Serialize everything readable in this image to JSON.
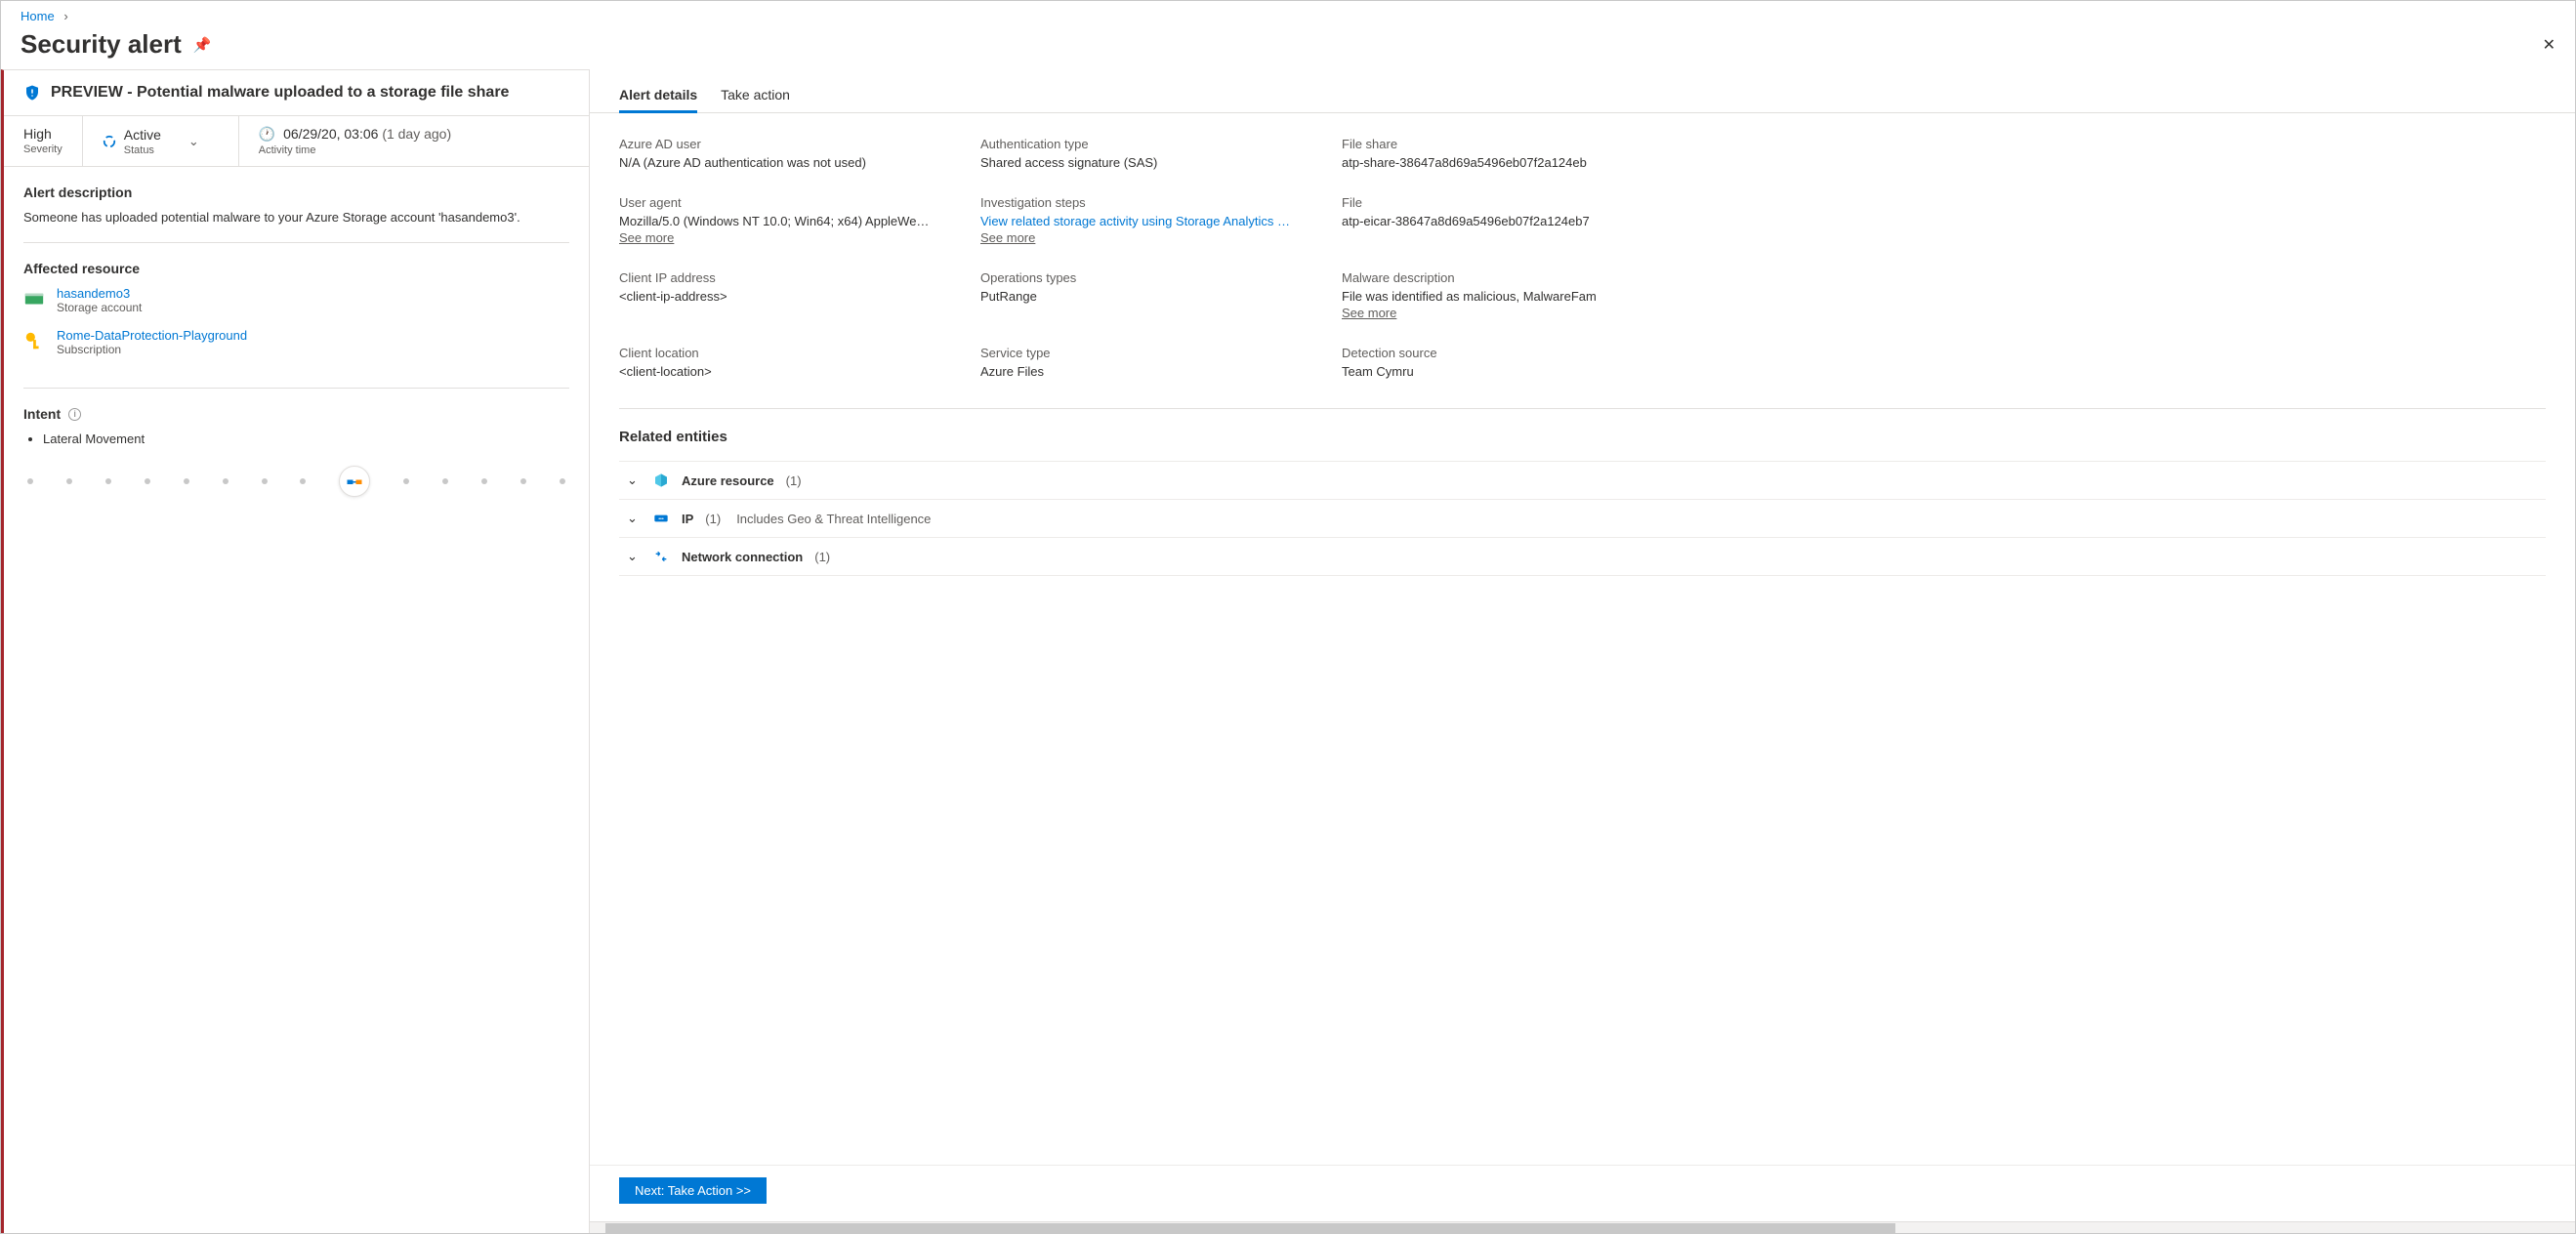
{
  "breadcrumb": {
    "home": "Home"
  },
  "pageTitle": "Security alert",
  "alertTitle": "PREVIEW - Potential malware uploaded to a storage file share",
  "metrics": {
    "severityValue": "High",
    "severityLabel": "Severity",
    "statusValue": "Active",
    "statusLabel": "Status",
    "timeValue": "06/29/20, 03:06",
    "timeAgo": "(1 day ago)",
    "timeLabel": "Activity time"
  },
  "alertDescription": {
    "title": "Alert description",
    "text": "Someone has uploaded potential malware to your Azure Storage account 'hasandemo3'."
  },
  "affectedResource": {
    "title": "Affected resource",
    "storage": {
      "name": "hasandemo3",
      "type": "Storage account"
    },
    "subscription": {
      "name": "Rome-DataProtection-Playground",
      "type": "Subscription"
    }
  },
  "intent": {
    "title": "Intent",
    "items": [
      "Lateral Movement"
    ]
  },
  "tabs": {
    "details": "Alert details",
    "action": "Take action"
  },
  "details": {
    "azureAdUser": {
      "label": "Azure AD user",
      "value": "N/A (Azure AD authentication was not used)"
    },
    "authType": {
      "label": "Authentication type",
      "value": "Shared access signature (SAS)"
    },
    "fileShare": {
      "label": "File share",
      "value": "atp-share-38647a8d69a5496eb07f2a124eb"
    },
    "userAgent": {
      "label": "User agent",
      "value": "Mozilla/5.0 (Windows NT 10.0; Win64; x64) AppleWe…",
      "seeMore": "See more"
    },
    "investigation": {
      "label": "Investigation steps",
      "value": "View related storage activity using Storage Analytics …",
      "seeMore": "See more"
    },
    "file": {
      "label": "File",
      "value": "atp-eicar-38647a8d69a5496eb07f2a124eb7"
    },
    "clientIp": {
      "label": "Client IP address",
      "value": "<client-ip-address>"
    },
    "opsTypes": {
      "label": "Operations types",
      "value": "PutRange"
    },
    "malwareDesc": {
      "label": "Malware description",
      "value": "File was identified as malicious, MalwareFam",
      "seeMore": "See more"
    },
    "clientLocation": {
      "label": "Client location",
      "value": "<client-location>"
    },
    "serviceType": {
      "label": "Service type",
      "value": "Azure Files"
    },
    "detectionSource": {
      "label": "Detection source",
      "value": "Team Cymru"
    }
  },
  "entities": {
    "title": "Related entities",
    "azureResource": {
      "label": "Azure resource",
      "count": "(1)"
    },
    "ip": {
      "label": "IP",
      "count": "(1)",
      "sub": "Includes Geo & Threat Intelligence"
    },
    "netConn": {
      "label": "Network connection",
      "count": "(1)"
    }
  },
  "footer": {
    "button": "Next: Take Action >>"
  }
}
